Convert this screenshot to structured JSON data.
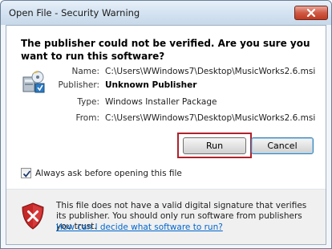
{
  "window": {
    "title": "Open File - Security Warning"
  },
  "dialog": {
    "headline": "The publisher could not be verified.  Are you sure you want to run this software?",
    "fields": [
      {
        "label": "Name:",
        "value": "C:\\Users\\WWindows7\\Desktop\\MusicWorks2.6.msi",
        "bold": false
      },
      {
        "label": "Publisher:",
        "value": "Unknown Publisher",
        "bold": true
      },
      {
        "label": "Type:",
        "value": "Windows Installer Package",
        "bold": false
      },
      {
        "label": "From:",
        "value": "C:\\Users\\WWindows7\\Desktop\\MusicWorks2.6.msi",
        "bold": false
      }
    ],
    "run_label": "Run",
    "cancel_label": "Cancel",
    "checkbox": {
      "label": "Always ask before opening this file",
      "checked": true
    },
    "footer": {
      "text": "This file does not have a valid digital signature that verifies its publisher.  You should only run software from publishers you trust.",
      "link": "How can I decide what software to run?"
    }
  },
  "icons": {
    "close": "close-icon",
    "package": "installer-package-icon",
    "shield": "security-shield-icon",
    "check": "check-icon"
  },
  "colors": {
    "highlight": "#b0222a",
    "link": "#0066cc",
    "close_button": "#c03a22",
    "shield": "#c62828"
  }
}
